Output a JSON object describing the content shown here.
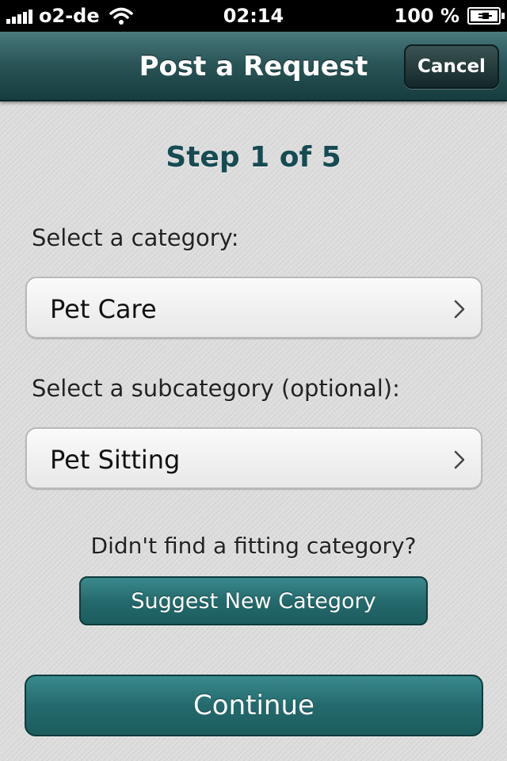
{
  "status_bar": {
    "carrier": "o2-de",
    "time": "02:14",
    "battery": "100 %",
    "signal_bars": 5
  },
  "nav": {
    "title": "Post a Request",
    "cancel_label": "Cancel"
  },
  "step": {
    "label": "Step 1 of 5"
  },
  "category": {
    "label": "Select a category:",
    "value": "Pet Care"
  },
  "subcategory": {
    "label": "Select a subcategory (optional):",
    "value": "Pet Sitting"
  },
  "suggest": {
    "prompt": "Didn't find a fitting category?",
    "button_label": "Suggest New Category"
  },
  "continue_label": "Continue",
  "colors": {
    "accent": "#246a6d",
    "nav_dark": "#163c3e",
    "step_text": "#174b52"
  }
}
